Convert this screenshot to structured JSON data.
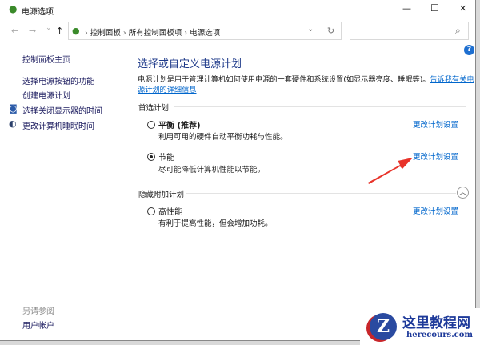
{
  "window": {
    "title": "电源选项",
    "minimize": "—",
    "maximize": "☐",
    "close": "✕"
  },
  "nav": {
    "back": "←",
    "forward": "→",
    "recent": "⌄",
    "up": "↑",
    "refresh": "↻",
    "dropdown": "⌄",
    "search_icon": "⌕"
  },
  "breadcrumb": [
    "控制面板",
    "所有控制面板项",
    "电源选项"
  ],
  "search": {
    "placeholder": ""
  },
  "sidebar": {
    "home": "控制面板主页",
    "items": [
      {
        "label": "选择电源按钮的功能"
      },
      {
        "label": "创建电源计划"
      },
      {
        "label": "选择关闭显示器的时间"
      },
      {
        "label": "更改计算机睡眠时间"
      }
    ],
    "see_also": "另请参阅",
    "see_also_items": [
      "用户帐户"
    ]
  },
  "main": {
    "heading": "选择或自定义电源计划",
    "desc": "电源计划是用于管理计算机如何使用电源的一套硬件和系统设置(如显示器亮度、睡眠等)。",
    "desc_link_1": "告诉我有关电",
    "desc_link_2": "源计划的详细信息",
    "preferred_label": "首选计划",
    "hidden_label": "隐藏附加计划",
    "plans": [
      {
        "name": "平衡 (推荐)",
        "desc": "利用可用的硬件自动平衡功耗与性能。",
        "link": "更改计划设置",
        "selected": false
      },
      {
        "name": "节能",
        "desc": "尽可能降低计算机性能以节能。",
        "link": "更改计划设置",
        "selected": true
      },
      {
        "name": "高性能",
        "desc": "有利于提高性能，但会增加功耗。",
        "link": "更改计划设置",
        "selected": false
      }
    ],
    "help": "?"
  },
  "watermark": {
    "title": "这里教程网",
    "url": "herecours.com",
    "logo_letter": "Z"
  },
  "colors": {
    "link": "#0066cc",
    "heading": "#1e3a8a",
    "arrow": "#e8332a"
  }
}
